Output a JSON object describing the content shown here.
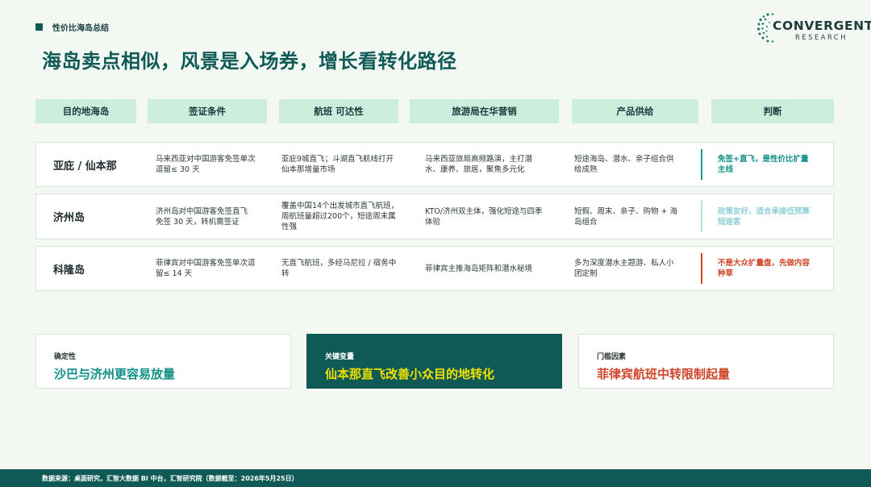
{
  "section_tag": "性价比海岛总结",
  "headline": "海岛卖点相似，风景是入场券，增长看转化路径",
  "logo": {
    "name": "CONVERGENT",
    "sub": "RESEARCH",
    "icon": "dotted-globe-icon"
  },
  "table": {
    "headers": [
      "目的地海岛",
      "签证条件",
      "航班 可达性",
      "旅游局在华营销",
      "产品供给",
      "判断"
    ],
    "rows": [
      {
        "name": "亚庇 / 仙本那",
        "visa": "马来西亚对中国游客免签单次逗留≤ 30 天",
        "flights": "亚庇9城直飞；斗湖直飞航线打开仙本那增量市场",
        "marketing": "马来西亚旅局高频路演，主打潜水、康养、旅居，聚焦多元化",
        "supply": "短途海岛、潜水、亲子组合供给成熟",
        "verdict": "免签+直飞，是性价比扩量主线",
        "verdict_color": "#0f8f86",
        "bar_color": "#159a92"
      },
      {
        "name": "济州岛",
        "visa": "济州岛对中国游客免签直飞免签 30 天，转机需签证",
        "flights": "覆盖中国14个出发城市直飞航班，周航班量超过200个，短途周末属性强",
        "marketing": "KTO/济州双主体，强化短途与四季体验",
        "supply": "短假、周末、亲子、购物 + 海岛组合",
        "verdict": "政策友好，适合承接低预算短途客",
        "verdict_color": "#8fd0d8",
        "bar_color": "#aee0e6"
      },
      {
        "name": "科隆岛",
        "visa": "菲律宾对中国游客免签单次逗留≤ 14 天",
        "flights": "无直飞航班，多经马尼拉 / 宿务中转",
        "marketing": "菲律宾主推海岛矩阵和潜水秘境",
        "supply": "多为深度潜水主题游、私人小团定制",
        "verdict": "不是大众扩量盘，先做内容种草",
        "verdict_color": "#d0452a",
        "bar_color": "#d0452a"
      }
    ]
  },
  "cards": [
    {
      "label": "确定性",
      "title": "沙巴与济州更容易放量",
      "title_color": "#0f8f86"
    },
    {
      "label": "关键变量",
      "title": "仙本那直飞改善小众目的地转化",
      "title_color": "#f0e000"
    },
    {
      "label": "门槛因素",
      "title": "菲律宾航班中转限制起量",
      "title_color": "#d0452a"
    }
  ],
  "footer": "数据来源：桌面研究，汇智大数据 BI 中台，汇智研究院（数据截至：2026年5月25日）"
}
